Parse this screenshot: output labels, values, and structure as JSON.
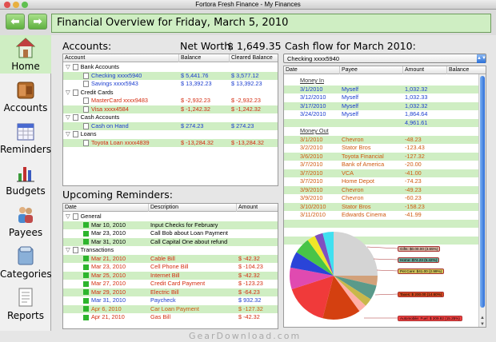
{
  "window": {
    "title": "Fortora Fresh Finance - My Finances"
  },
  "toolbar": {
    "back_icon": "arrow-left",
    "forward_icon": "arrow-right",
    "back_label": "⬅",
    "forward_label": "➡"
  },
  "header": {
    "title": "Financial Overview for Friday, March 5, 2010"
  },
  "sidebar": {
    "items": [
      {
        "label": "Home",
        "icon": "house-icon",
        "active": true
      },
      {
        "label": "Accounts",
        "icon": "wallet-icon"
      },
      {
        "label": "Reminders",
        "icon": "calendar-icon"
      },
      {
        "label": "Budgets",
        "icon": "bar-chart-icon"
      },
      {
        "label": "Payees",
        "icon": "people-icon"
      },
      {
        "label": "Categories",
        "icon": "folder-icon"
      },
      {
        "label": "Reports",
        "icon": "report-icon"
      }
    ]
  },
  "accounts": {
    "heading": "Accounts:",
    "networth_label": "Net Worth:",
    "networth_value": "$ 1,649.35",
    "columns": [
      "Account",
      "Balance",
      "Cleared Balance"
    ],
    "groups": [
      {
        "name": "Bank Accounts",
        "items": [
          {
            "name": "Checking xxxx5940",
            "balance": "$ 5,441.76",
            "cleared": "$ 3,577.12",
            "color": "blue",
            "highlight": true
          },
          {
            "name": "Savings xxxx5943",
            "balance": "$ 13,392.23",
            "cleared": "$ 13,392.23",
            "color": "blue",
            "highlight": false
          }
        ]
      },
      {
        "name": "Credit Cards",
        "items": [
          {
            "name": "MasterCard xxxx9483",
            "balance": "$ -2,932.23",
            "cleared": "$ -2,932.23",
            "color": "red",
            "highlight": false
          },
          {
            "name": "Visa xxxx4584",
            "balance": "$ -1,242.32",
            "cleared": "$ -1,242.32",
            "color": "red",
            "highlight": true
          }
        ]
      },
      {
        "name": "Cash Accounts",
        "items": [
          {
            "name": "Cash on Hand",
            "balance": "$ 274.23",
            "cleared": "$ 274.23",
            "color": "blue",
            "highlight": true
          }
        ]
      },
      {
        "name": "Loans",
        "items": [
          {
            "name": "Toyota Loan xxxx4839",
            "balance": "$ -13,284.32",
            "cleared": "$ -13,284.32",
            "color": "red",
            "highlight": true
          }
        ]
      }
    ]
  },
  "reminders": {
    "heading": "Upcoming Reminders:",
    "columns": [
      "Date",
      "Description",
      "Amount"
    ],
    "groups": [
      {
        "name": "General",
        "items": [
          {
            "date": "Mar 10, 2010",
            "desc": "Input Checks for February",
            "amount": "",
            "color": "black",
            "highlight": true
          },
          {
            "date": "Mar 23, 2010",
            "desc": "Call Bob about Loan Payment",
            "amount": "",
            "color": "black",
            "highlight": false
          },
          {
            "date": "Mar 31, 2010",
            "desc": "Call Capital One about refund",
            "amount": "",
            "color": "black",
            "highlight": true
          }
        ]
      },
      {
        "name": "Transactions",
        "items": [
          {
            "date": "Mar 21, 2010",
            "desc": "Cable Bill",
            "amount": "$ -42.32",
            "color": "red",
            "highlight": true
          },
          {
            "date": "Mar 23, 2010",
            "desc": "Cell Phone Bill",
            "amount": "$ -104.23",
            "color": "red",
            "highlight": false
          },
          {
            "date": "Mar 25, 2010",
            "desc": "Internet Bill",
            "amount": "$ -42.32",
            "color": "red",
            "highlight": true
          },
          {
            "date": "Mar 27, 2010",
            "desc": "Credit Card Payment",
            "amount": "$ -123.23",
            "color": "red",
            "highlight": false
          },
          {
            "date": "Mar 29, 2010",
            "desc": "Electric Bill",
            "amount": "$ -64.23",
            "color": "red",
            "highlight": true
          },
          {
            "date": "Mar 31, 2010",
            "desc": "Paycheck",
            "amount": "$ 932.32",
            "color": "blue",
            "highlight": false
          },
          {
            "date": "Apr 6, 2010",
            "desc": "Car Loan Payment",
            "amount": "$ -127.32",
            "color": "orange",
            "highlight": true
          },
          {
            "date": "Apr 21, 2010",
            "desc": "Gas Bill",
            "amount": "$ -42.32",
            "color": "red",
            "highlight": false
          }
        ]
      }
    ]
  },
  "cashflow": {
    "heading": "Cash flow for March 2010:",
    "selected_account": "Checking xxxx5940",
    "columns": [
      "Date",
      "Payee",
      "Amount",
      "Balance"
    ],
    "money_in_label": "Money In",
    "money_in": [
      {
        "date": "3/1/2010",
        "payee": "Myself",
        "amount": "1,032.32",
        "highlight": true
      },
      {
        "date": "3/12/2010",
        "payee": "Myself",
        "amount": "1,032.33",
        "highlight": false
      },
      {
        "date": "3/17/2010",
        "payee": "Myself",
        "amount": "1,032.32",
        "highlight": true
      },
      {
        "date": "3/24/2010",
        "payee": "Myself",
        "amount": "1,864.64",
        "highlight": false
      }
    ],
    "money_in_total": "4,961.61",
    "money_out_label": "Money Out",
    "money_out": [
      {
        "date": "3/1/2010",
        "payee": "Chevron",
        "amount": "-48.23",
        "highlight": true
      },
      {
        "date": "3/2/2010",
        "payee": "Stator Bros",
        "amount": "-123.43",
        "highlight": false
      },
      {
        "date": "3/6/2010",
        "payee": "Toyota Financial",
        "amount": "-127.32",
        "highlight": true
      },
      {
        "date": "3/7/2010",
        "payee": "Bank of America",
        "amount": "-20.00",
        "highlight": false
      },
      {
        "date": "3/7/2010",
        "payee": "VCA",
        "amount": "-41.00",
        "highlight": true
      },
      {
        "date": "3/7/2010",
        "payee": "Home Depot",
        "amount": "-74.23",
        "highlight": false
      },
      {
        "date": "3/9/2010",
        "payee": "Chevron",
        "amount": "-49.23",
        "highlight": true
      },
      {
        "date": "3/9/2010",
        "payee": "Chevron",
        "amount": "-60.23",
        "highlight": false
      },
      {
        "date": "3/10/2010",
        "payee": "Stator Bros",
        "amount": "-158.23",
        "highlight": true
      },
      {
        "date": "3/11/2010",
        "payee": "Edwards Cinema",
        "amount": "-41.99",
        "highlight": false
      }
    ]
  },
  "pie": {
    "slices": [
      {
        "color": "#d4d4d4",
        "pct": 25
      },
      {
        "color": "#d2a17a",
        "pct": 3.6
      },
      {
        "color": "#5a9a8a",
        "pct": 5.4
      },
      {
        "color": "#c9b84a",
        "pct": 3
      },
      {
        "color": "#ffb0a8",
        "pct": 3
      },
      {
        "color": "#d44010",
        "pct": 14
      },
      {
        "color": "#f03a3a",
        "pct": 16
      },
      {
        "color": "#e04ab0",
        "pct": 8
      },
      {
        "color": "#2a44d8",
        "pct": 6
      },
      {
        "color": "#48c448",
        "pct": 6
      },
      {
        "color": "#f0e628",
        "pct": 3
      },
      {
        "color": "#8050c0",
        "pct": 3
      },
      {
        "color": "#40e0f0",
        "pct": 4
      }
    ],
    "labels": [
      {
        "text": "Gifts: $0.00.00 (3.65%)",
        "bg": "#d7b4a4"
      },
      {
        "text": "Home: $74.23 (5.42%)",
        "bg": "#6ba89a"
      },
      {
        "text": "Pet Care: $41.00 (2.99%)",
        "bg": "#d4c45a"
      },
      {
        "text": "Taxes: $ 200.00 (14.60%)",
        "bg": "#d44a20"
      },
      {
        "text": "Automobile: Fuel: $ 209.82 (15.25%)",
        "bg": "#f04040"
      }
    ]
  },
  "watermark": "GearDownload.com"
}
